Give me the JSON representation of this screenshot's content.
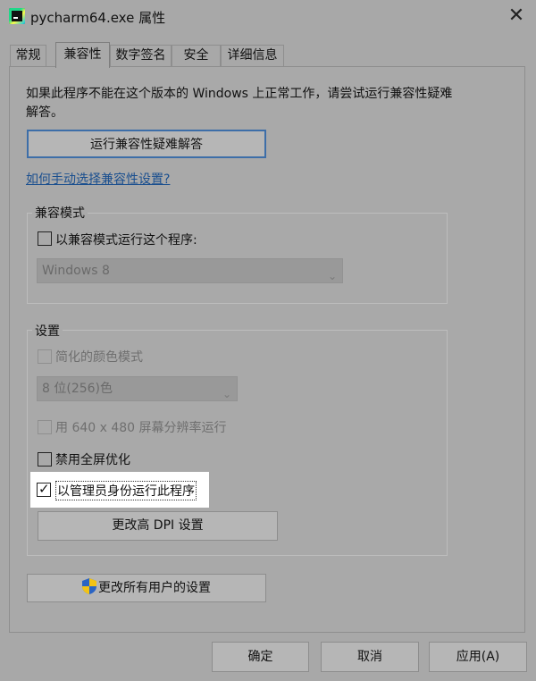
{
  "window": {
    "title": "pycharm64.exe 属性",
    "close_label": "✕"
  },
  "tabs": [
    {
      "label": "常规"
    },
    {
      "label": "兼容性"
    },
    {
      "label": "数字签名"
    },
    {
      "label": "安全"
    },
    {
      "label": "详细信息"
    }
  ],
  "active_tab": "兼容性",
  "intro_text": "如果此程序不能在这个版本的 Windows 上正常工作，请尝试运行兼容性疑难解答。",
  "troubleshoot_button": "运行兼容性疑难解答",
  "help_link": "如何手动选择兼容性设置?",
  "compat_mode": {
    "title": "兼容模式",
    "checkbox_label": "以兼容模式运行这个程序:",
    "checked": false,
    "os_select_value": "Windows 8"
  },
  "settings": {
    "title": "设置",
    "reduced_color_label": "简化的颜色模式",
    "color_select_value": "8 位(256)色",
    "res_640_label": "用 640 x 480 屏幕分辨率运行",
    "disable_fullscreen_label": "禁用全屏优化",
    "run_as_admin_label": "以管理员身份运行此程序",
    "run_as_admin_checked": true,
    "dpi_button": "更改高 DPI 设置"
  },
  "all_users_button": "更改所有用户的设置",
  "footer": {
    "ok": "确定",
    "cancel": "取消",
    "apply": "应用(A)"
  },
  "colors": {
    "window_bg": "#a8a8a8",
    "highlight": "#ffffff",
    "link": "#1a4f8f",
    "focus_border": "#3d6ea8"
  }
}
